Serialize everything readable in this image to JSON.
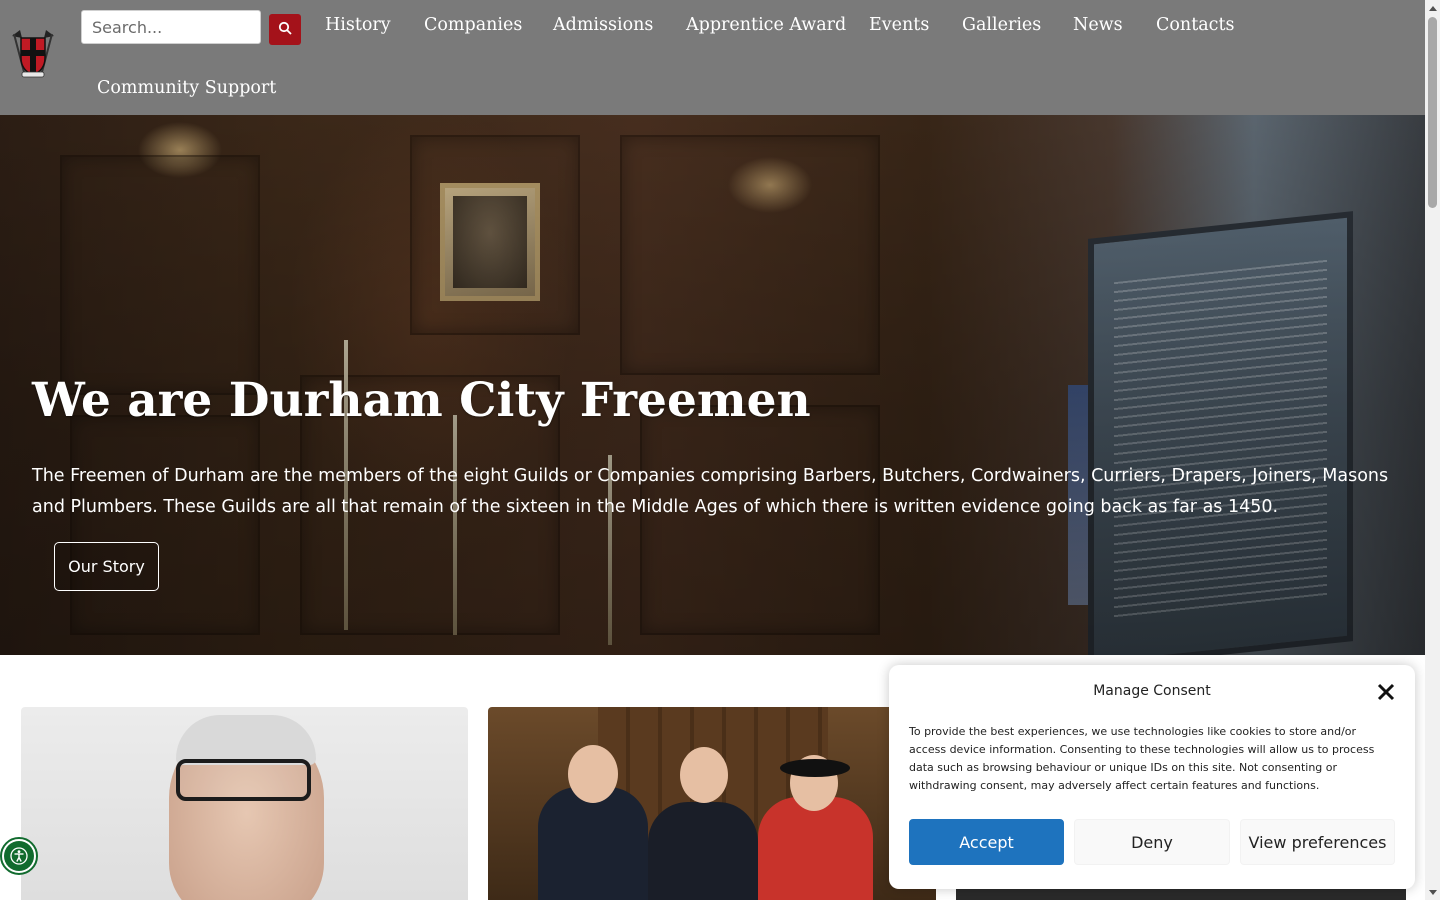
{
  "header": {
    "logo_icon": "durham-freemen-crest-icon",
    "search": {
      "placeholder": "Search...",
      "value": "",
      "button_icon": "search-icon"
    },
    "nav": [
      {
        "label": "History"
      },
      {
        "label": "Companies"
      },
      {
        "label": "Admissions"
      },
      {
        "label": "Apprentice Award"
      },
      {
        "label": "Events"
      },
      {
        "label": "Galleries"
      },
      {
        "label": "News"
      },
      {
        "label": "Contacts"
      },
      {
        "label": "Community Support"
      }
    ]
  },
  "hero": {
    "title": "We are Durham City Freemen",
    "text": "The Freemen of Durham are the members of the eight Guilds or Companies comprising Barbers, Butchers, Cordwainers, Curriers, Drapers, Joiners, Masons and Plumbers. These Guilds are all that remain of the sixteen in the Middle Ages of which there is written evidence going back as far as 1450.",
    "button_label": "Our Story"
  },
  "cards": [
    {
      "image": "portrait-photo"
    },
    {
      "image": "group-photo-town-hall"
    },
    {
      "image": "event-photo"
    }
  ],
  "consent": {
    "title": "Manage Consent",
    "close_icon": "close-icon",
    "text": "To provide the best experiences, we use technologies like cookies to store and/or access device information. Consenting to these technologies will allow us to process data such as browsing behaviour or unique IDs on this site. Not consenting or withdrawing consent, may adversely affect certain features and functions.",
    "accept_label": "Accept",
    "deny_label": "Deny",
    "preferences_label": "View preferences"
  },
  "accessibility": {
    "icon": "accessibility-icon"
  },
  "colors": {
    "header_bg": "#7a7a7a",
    "search_button": "#a4121a",
    "accept_button": "#1e73be",
    "accessibility_green": "#116b2e"
  }
}
